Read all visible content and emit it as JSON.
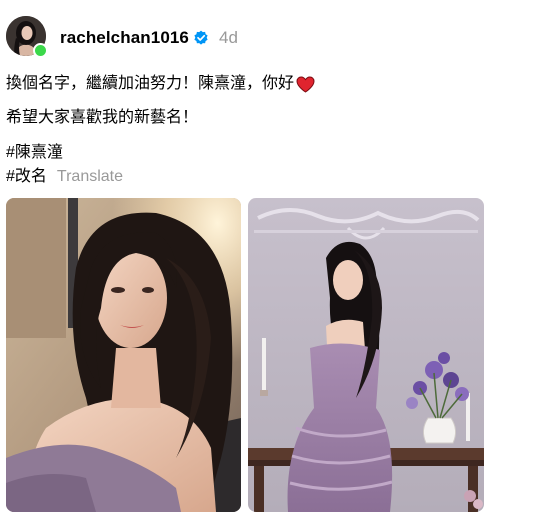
{
  "post": {
    "username": "rachelchan1016",
    "verified": true,
    "timestamp": "4d",
    "online": true,
    "caption": {
      "line1": "換個名字，繼續加油努力！陳熹潼，你好",
      "line1_emoji": "heart-icon",
      "line2": "希望大家喜歡我的新藝名！",
      "hashtag1": "#陳熹潼",
      "hashtag2": "#改名"
    },
    "translate_label": "Translate",
    "images": [
      {
        "icon": "portrait-photo"
      },
      {
        "icon": "purple-dress-photo"
      }
    ]
  },
  "colors": {
    "verified_blue": "#0095f6",
    "heart_red": "#e0242e",
    "muted_text": "#999999",
    "online_green": "#3bd84a"
  }
}
